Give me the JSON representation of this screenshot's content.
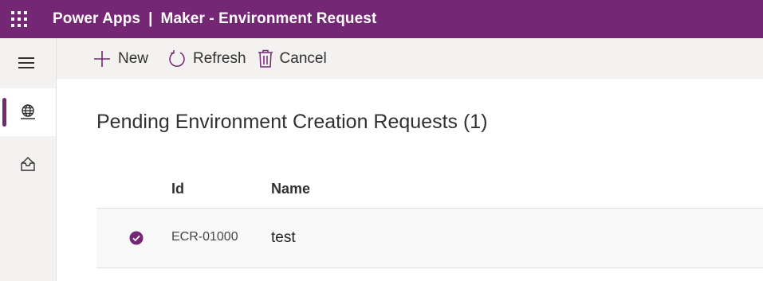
{
  "app": {
    "product": "Power Apps",
    "separator": "|",
    "title": "Maker - Environment Request",
    "accent_color": "#742774"
  },
  "sidebar": {
    "menu_icon": "hamburger-icon",
    "items": [
      {
        "id": "environments",
        "icon": "globe-icon",
        "active": true
      },
      {
        "id": "requests",
        "icon": "inbox-tray-icon",
        "active": false
      }
    ]
  },
  "commandbar": {
    "new_label": "New",
    "refresh_label": "Refresh",
    "cancel_label": "Cancel"
  },
  "main": {
    "title": "Pending Environment Creation Requests (1)",
    "columns": [
      "Id",
      "Name"
    ],
    "rows": [
      {
        "id": "ECR-01000",
        "name": "test",
        "selected": true
      }
    ]
  }
}
